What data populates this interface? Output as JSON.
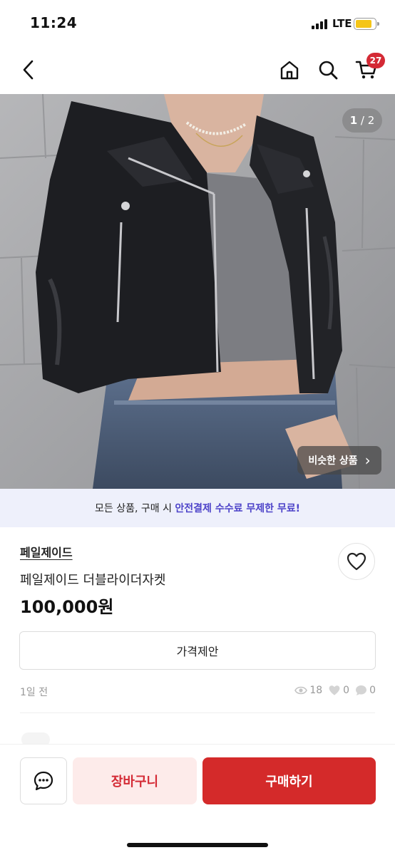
{
  "status_bar": {
    "time": "11:24",
    "network": "LTE",
    "battery_level": 0.85,
    "battery_color": "#f5c518"
  },
  "nav": {
    "back_icon": "chevron-left-icon",
    "home_icon": "home-icon",
    "search_icon": "search-icon",
    "cart_icon": "cart-icon",
    "cart_count": "27"
  },
  "hero": {
    "page_current": "1",
    "page_separator": " / ",
    "page_total": "2",
    "similar_label": "비슷한 상품",
    "similar_chevron": "›"
  },
  "promo": {
    "prefix": "모든 상품, 구매 시 ",
    "highlight": "안전결제 수수료 무제한 무료!",
    "highlight_color": "#4d43c9"
  },
  "product": {
    "shop_name": "페일제이드",
    "title": "페일제이드 더블라이더자켓",
    "price": "100,000원",
    "offer_label": "가격제안",
    "posted": "1일 전",
    "views": "18",
    "likes": "0",
    "chats": "0"
  },
  "actions": {
    "cart_label": "장바구니",
    "buy_label": "구매하기",
    "accent_color": "#d42a2a"
  }
}
